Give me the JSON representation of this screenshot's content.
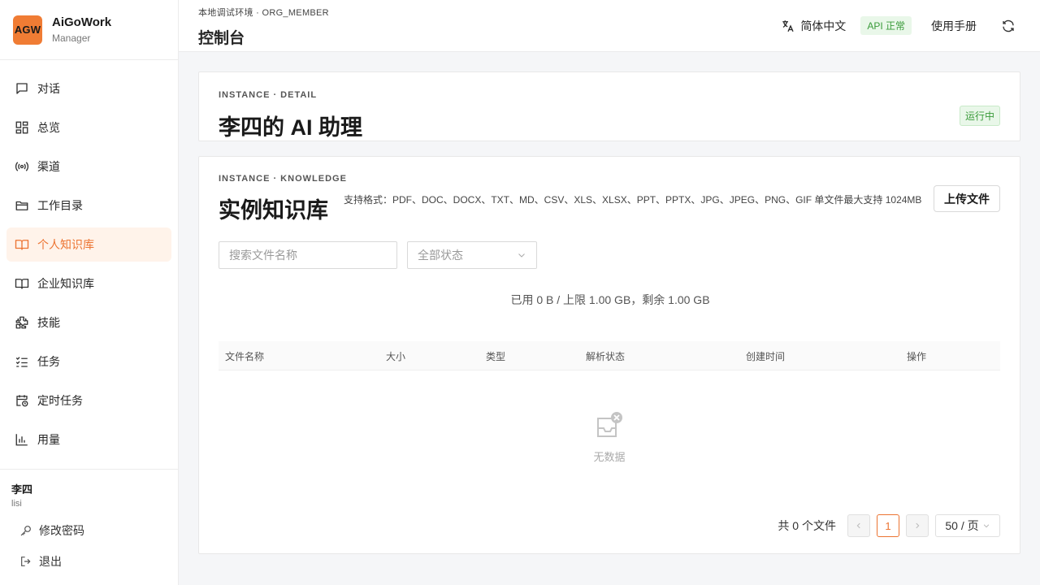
{
  "brand": {
    "logo_text": "AGW",
    "name": "AiGoWork",
    "role": "Manager"
  },
  "sidebar": {
    "items": [
      {
        "label": "对话",
        "icon": "chat-icon",
        "active": false
      },
      {
        "label": "总览",
        "icon": "dashboard-icon",
        "active": false
      },
      {
        "label": "渠道",
        "icon": "broadcast-icon",
        "active": false
      },
      {
        "label": "工作目录",
        "icon": "folder-icon",
        "active": false
      },
      {
        "label": "个人知识库",
        "icon": "book-open-icon",
        "active": true
      },
      {
        "label": "企业知识库",
        "icon": "book-icon",
        "active": false
      },
      {
        "label": "技能",
        "icon": "puzzle-icon",
        "active": false
      },
      {
        "label": "任务",
        "icon": "checklist-icon",
        "active": false
      },
      {
        "label": "定时任务",
        "icon": "calendar-clock-icon",
        "active": false
      },
      {
        "label": "用量",
        "icon": "bar-chart-icon",
        "active": false
      }
    ]
  },
  "user": {
    "name": "李四",
    "username": "lisi",
    "change_password": "修改密码",
    "logout": "退出"
  },
  "header": {
    "env": "本地调试环境 · ORG_MEMBER",
    "title": "控制台",
    "language": "简体中文",
    "api_status": "API 正常",
    "manual": "使用手册"
  },
  "instance": {
    "eyebrow": "INSTANCE · DETAIL",
    "name": "李四的 AI 助理",
    "status": "运行中"
  },
  "knowledge": {
    "eyebrow": "INSTANCE · KNOWLEDGE",
    "title": "实例知识库",
    "formats": "支持格式：PDF、DOC、DOCX、TXT、MD、CSV、XLS、XLSX、PPT、PPTX、JPG、JPEG、PNG、GIF   单文件最大支持 1024MB",
    "upload_label": "上传文件",
    "search_placeholder": "搜索文件名称",
    "status_filter": "全部状态",
    "usage": "已用 0 B / 上限 1.00 GB，剩余 1.00 GB",
    "columns": [
      "文件名称",
      "大小",
      "类型",
      "解析状态",
      "创建时间",
      "操作"
    ],
    "empty_text": "无数据",
    "pagination": {
      "total": "共 0 个文件",
      "current_page": "1",
      "page_size": "50 / 页"
    }
  },
  "colors": {
    "accent": "#ec7432",
    "success": "#3a9b3a",
    "success_bg": "#e9f7e9"
  }
}
